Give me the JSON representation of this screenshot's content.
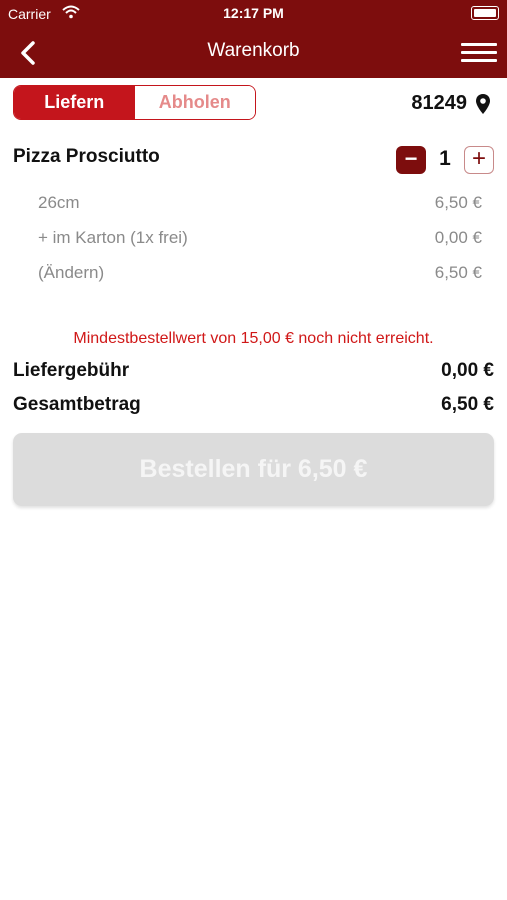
{
  "status_bar": {
    "carrier": "Carrier",
    "time": "12:17 PM"
  },
  "nav": {
    "title": "Warenkorb"
  },
  "delivery_toggle": {
    "options": [
      "Liefern",
      "Abholen"
    ],
    "selected": "Liefern"
  },
  "location": {
    "zip": "81249"
  },
  "cart": {
    "item": {
      "name": "Pizza Prosciutto",
      "quantity": "1"
    },
    "details": [
      {
        "label": "26cm",
        "price": "6,50 €"
      },
      {
        "label": "+ im Karton (1x frei)",
        "price": "0,00 €"
      },
      {
        "label": "(Ändern)",
        "price": "6,50 €"
      }
    ]
  },
  "warning": "Mindestbestellwert von 15,00 € noch nicht erreicht.",
  "summary": {
    "delivery_fee_label": "Liefergebühr",
    "delivery_fee": "0,00 €",
    "total_label": "Gesamtbetrag",
    "total": "6,50 €"
  },
  "order_button": {
    "label": "Bestellen für 6,50 €"
  },
  "colors": {
    "brand": "#7d0d0d",
    "accent": "#c4151c",
    "warning": "#d01818",
    "disabled_button": "#dcdcdc"
  }
}
